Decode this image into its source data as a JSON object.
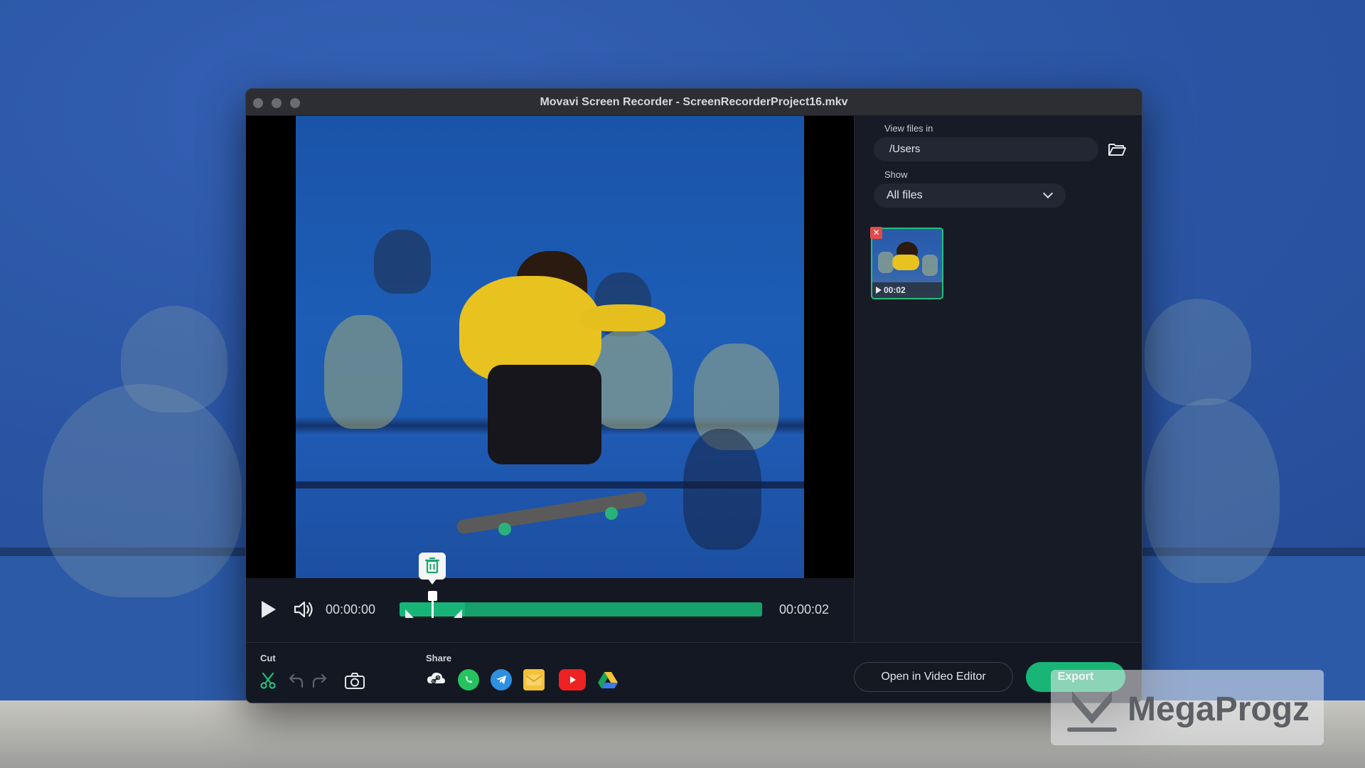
{
  "window": {
    "title": "Movavi Screen Recorder - ScreenRecorderProject16.mkv"
  },
  "player": {
    "current_time": "00:00:00",
    "total_time": "00:00:02",
    "selection_start_fraction": 0.0,
    "selection_end_fraction": 0.18,
    "playhead_fraction": 0.09
  },
  "toolbar": {
    "cut_label": "Cut",
    "share_label": "Share",
    "share_targets": [
      "link-icon",
      "whatsapp-icon",
      "telegram-icon",
      "email-icon",
      "youtube-icon",
      "google-drive-icon"
    ],
    "open_editor_label": "Open in Video Editor",
    "export_label": "Export"
  },
  "panel": {
    "view_files_label": "View files in",
    "path_value": "/Users",
    "show_label": "Show",
    "show_selected": "All files",
    "files": [
      {
        "duration": "00:02"
      }
    ]
  },
  "watermark": {
    "text": "MegaProgz"
  },
  "colors": {
    "accent_green": "#18b576",
    "window_bg": "#141822",
    "panel_bg": "#171b25",
    "desktop_blue": "#2c57a7"
  }
}
